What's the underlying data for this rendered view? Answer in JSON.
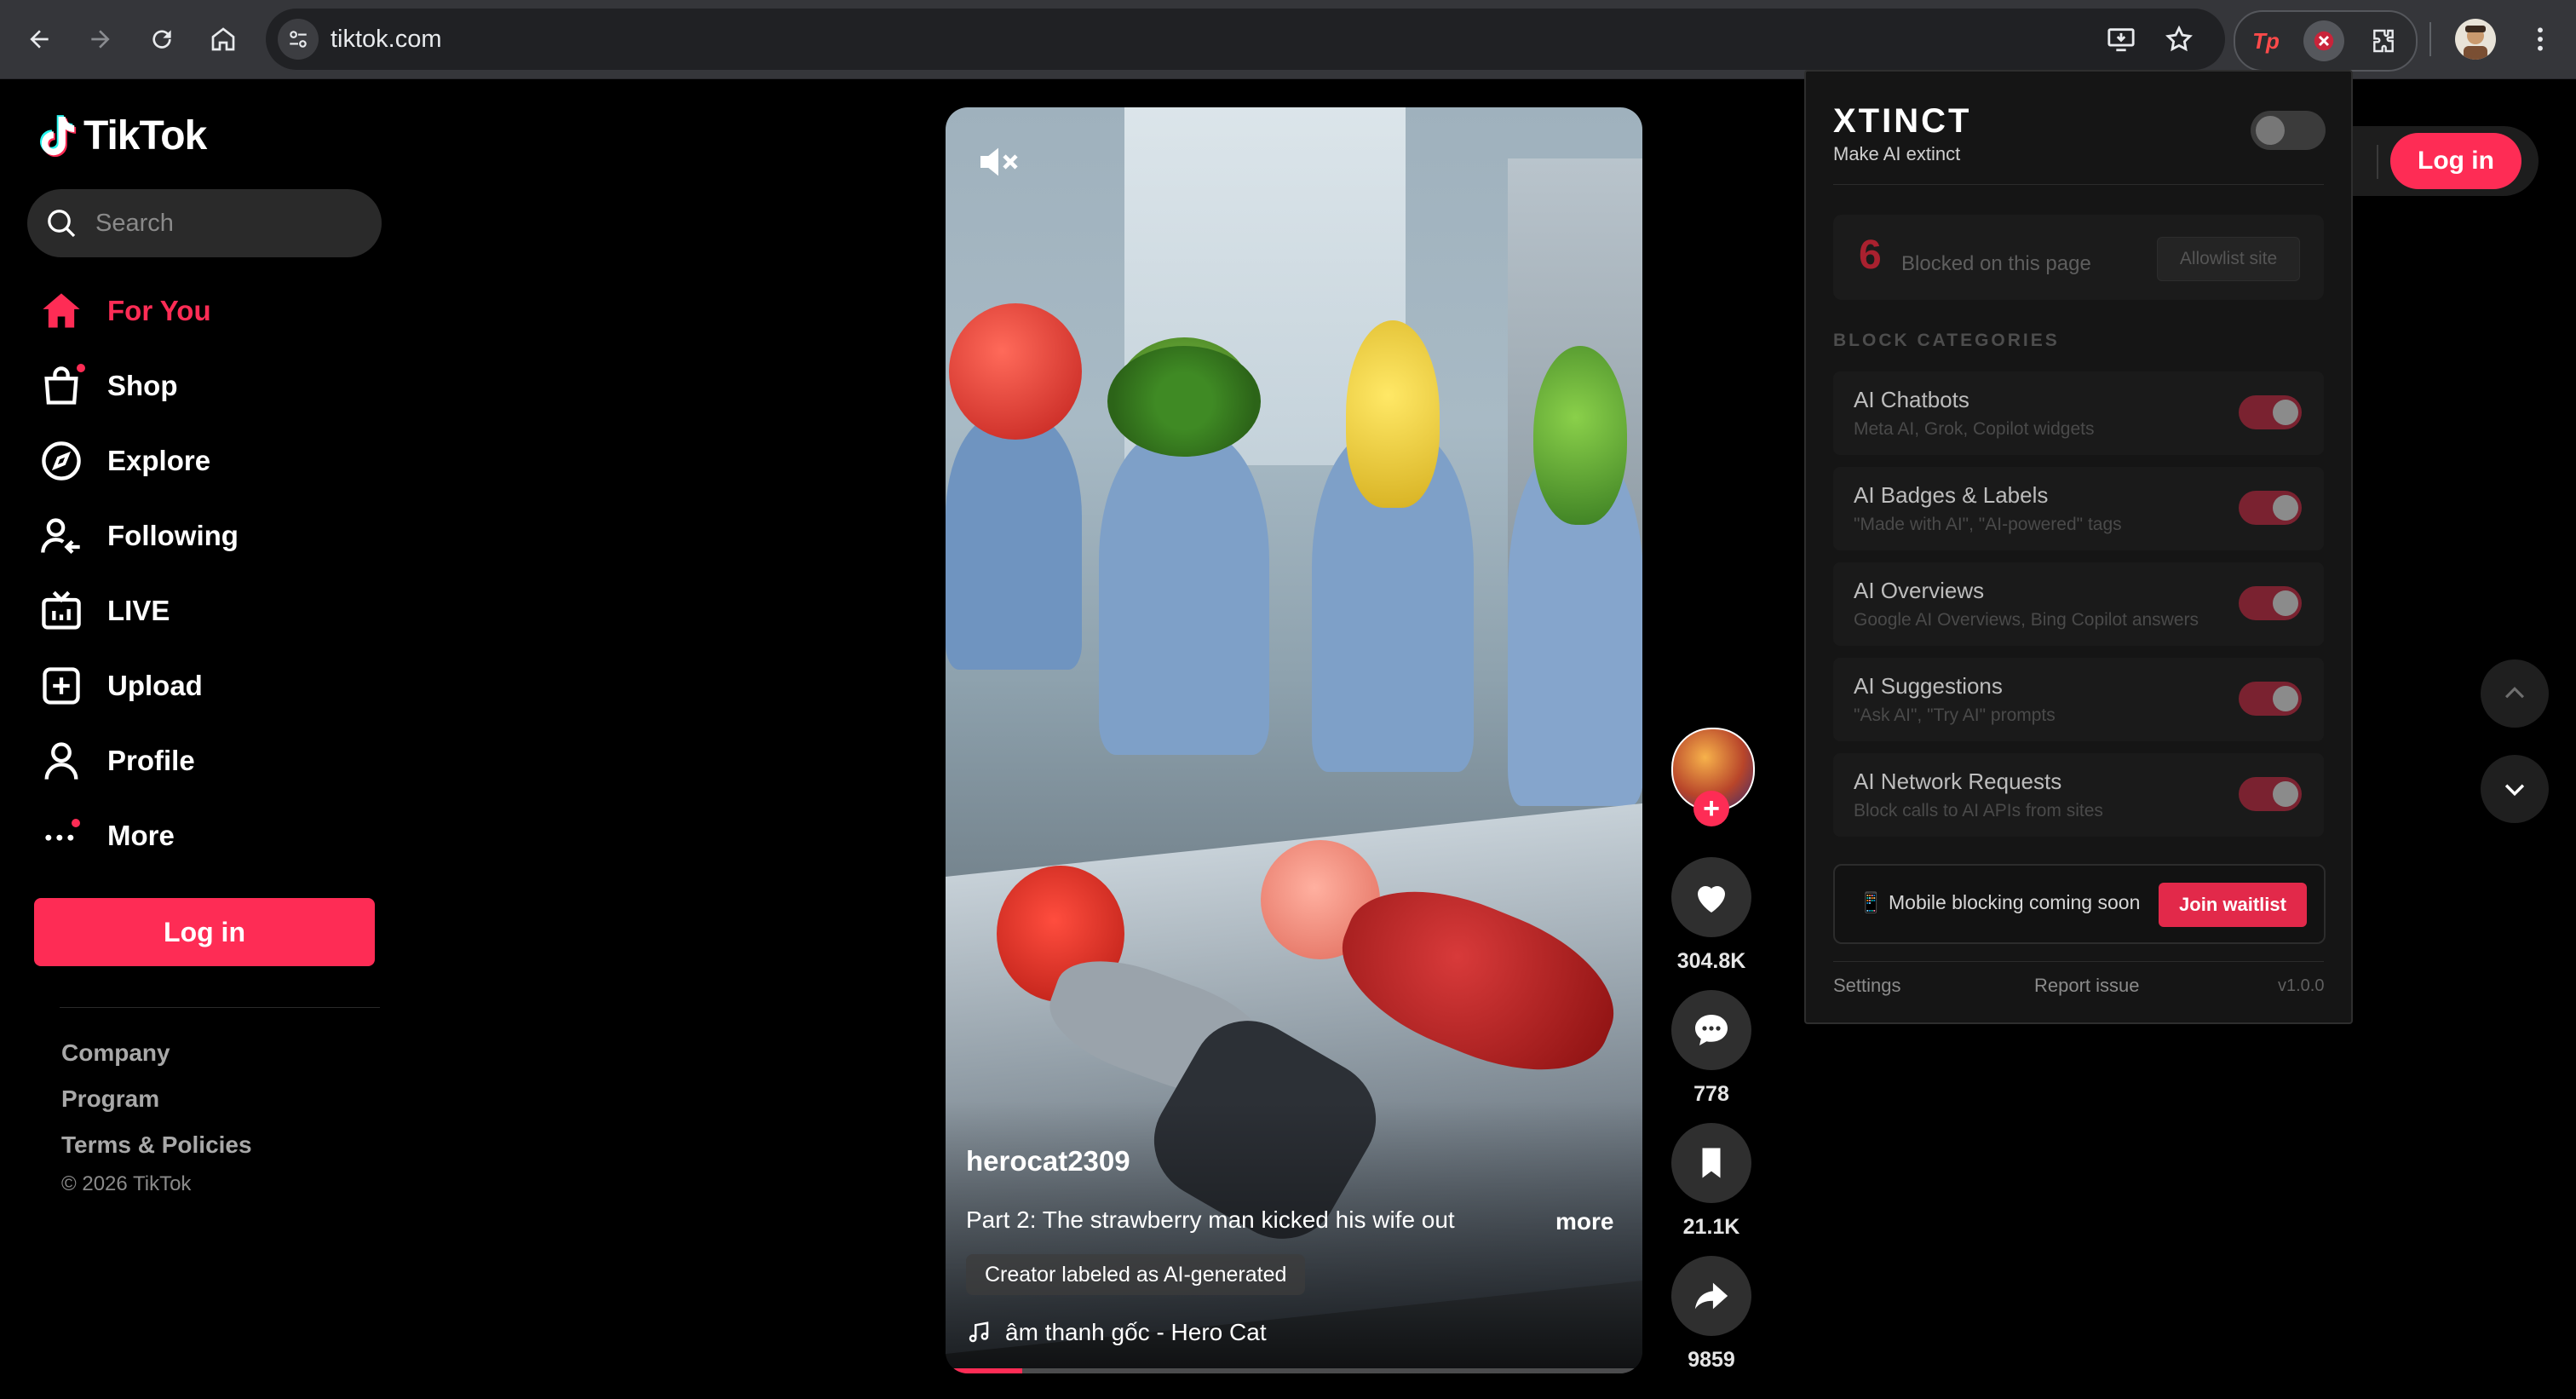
{
  "browser": {
    "url": "tiktok.com",
    "icons": [
      "back-arrow-icon",
      "forward-arrow-icon",
      "reload-icon",
      "home-icon",
      "site-info-icon",
      "install-app-icon",
      "bookmark-star-icon",
      "tp-extension-icon",
      "xtinct-extension-icon",
      "extensions-puzzle-icon",
      "profile-avatar",
      "menu-kebab-icon"
    ],
    "tp_label": "Tp"
  },
  "tiktok": {
    "brand": "TikTok",
    "search_placeholder": "Search",
    "nav": [
      {
        "label": "For You",
        "icon": "home-icon",
        "active": true
      },
      {
        "label": "Shop",
        "icon": "shopping-bag-icon"
      },
      {
        "label": "Explore",
        "icon": "compass-icon"
      },
      {
        "label": "Following",
        "icon": "following-icon"
      },
      {
        "label": "LIVE",
        "icon": "live-tv-icon"
      },
      {
        "label": "Upload",
        "icon": "upload-plus-icon"
      },
      {
        "label": "Profile",
        "icon": "person-icon"
      },
      {
        "label": "More",
        "icon": "more-dots-icon"
      }
    ],
    "login_label": "Log in",
    "footer": {
      "company": "Company",
      "program": "Program",
      "terms": "Terms & Policies",
      "copyright": "© 2026 TikTok"
    },
    "accent": "#fe2c55"
  },
  "video": {
    "author": "herocat2309",
    "caption": "Part 2: The strawberry man kicked his wife out",
    "more": "more",
    "ai_label": "Creator labeled as AI-generated",
    "music": "âm thanh gốc - Hero Cat",
    "progress": 0.11,
    "muted": true
  },
  "actions": {
    "likes": "304.8K",
    "comments": "778",
    "saves": "21.1K",
    "shares": "9859"
  },
  "page": {
    "login_label": "Log in"
  },
  "extension": {
    "title": "XTINCT",
    "subtitle": "Make AI extinct",
    "enabled": false,
    "blocked_count": "6",
    "blocked_label": "Blocked on this page",
    "allowlist_label": "Allowlist site",
    "categories_heading": "BLOCK CATEGORIES",
    "categories": [
      {
        "name": "AI Chatbots",
        "desc": "Meta AI, Grok, Copilot widgets",
        "on": true
      },
      {
        "name": "AI Badges & Labels",
        "desc": "\"Made with AI\", \"AI-powered\" tags",
        "on": true
      },
      {
        "name": "AI Overviews",
        "desc": "Google AI Overviews, Bing Copilot answers",
        "on": true
      },
      {
        "name": "AI Suggestions",
        "desc": "\"Ask AI\", \"Try AI\" prompts",
        "on": true
      },
      {
        "name": "AI Network Requests",
        "desc": "Block calls to AI APIs from sites",
        "on": true
      }
    ],
    "mobile_text": "📱 Mobile blocking coming soon",
    "waitlist_label": "Join waitlist",
    "settings_label": "Settings",
    "report_label": "Report issue",
    "version": "v1.0.0",
    "accent": "#e2294a"
  }
}
